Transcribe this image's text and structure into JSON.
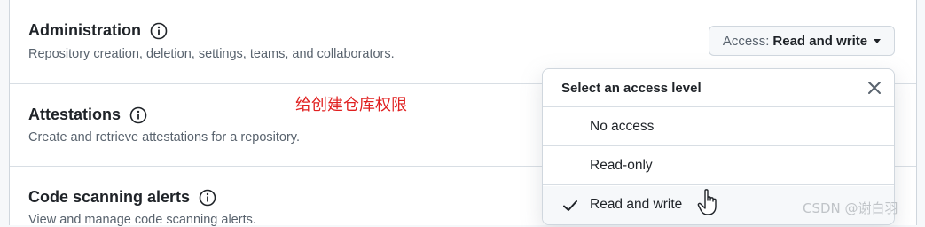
{
  "rows": [
    {
      "title": "Administration",
      "description": "Repository creation, deletion, settings, teams, and collaborators."
    },
    {
      "title": "Attestations",
      "description": "Create and retrieve attestations for a repository."
    },
    {
      "title": "Code scanning alerts",
      "description": "View and manage code scanning alerts."
    }
  ],
  "access_button": {
    "prefix": "Access:",
    "value": "Read and write"
  },
  "annotation": "给创建仓库权限",
  "dropdown": {
    "title": "Select an access level",
    "options": [
      {
        "label": "No access",
        "selected": false
      },
      {
        "label": "Read-only",
        "selected": false
      },
      {
        "label": "Read and write",
        "selected": true
      }
    ]
  },
  "watermark": "CSDN @谢白羽",
  "icons": {
    "info": "info-icon",
    "close": "close-icon",
    "check": "check-icon",
    "caret": "caret-down-icon",
    "cursor": "hand-pointer-icon"
  },
  "colors": {
    "annotation": "#e02020",
    "muted_text": "#59636e",
    "border": "#d0d7de"
  }
}
